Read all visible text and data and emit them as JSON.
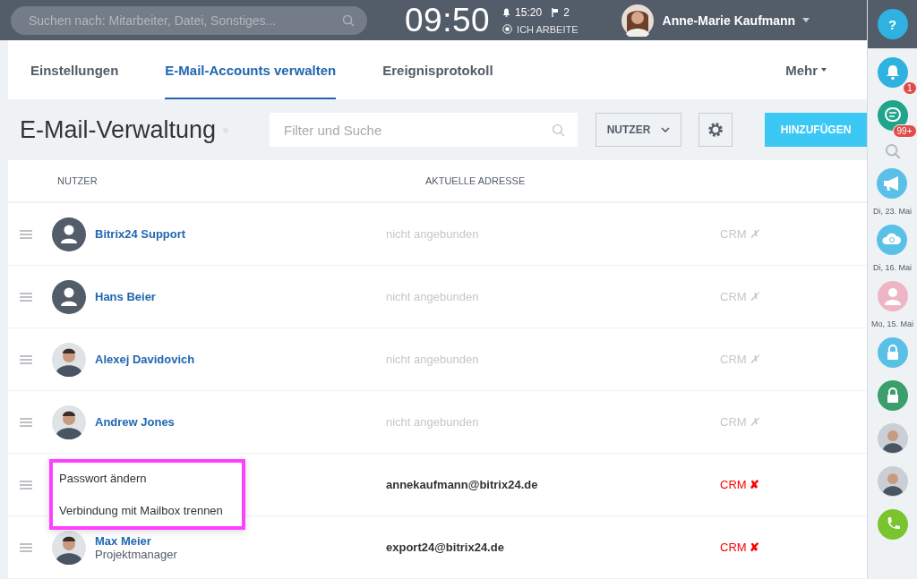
{
  "topbar": {
    "search": {
      "placeholder": "Suchen nach: Mitarbeiter, Datei, Sonstiges..."
    },
    "clock": "09:50",
    "reminder_time": "15:20",
    "flag_count": "2",
    "work_status": "ICH ARBEITE",
    "user_name": "Anne-Marie Kaufmann",
    "help": "?"
  },
  "tabs": [
    {
      "label": "Einstellungen",
      "selected": false
    },
    {
      "label": "E-Mail-Accounts verwalten",
      "selected": true
    },
    {
      "label": "Ereignisprotokoll",
      "selected": false
    }
  ],
  "more_tab": "Mehr",
  "page_title": "E-Mail-Verwaltung",
  "filter": {
    "placeholder": "Filter und Suche"
  },
  "user_dropdown": "NUTZER",
  "add_button": "HINZUFÜGEN",
  "table": {
    "columns": [
      "NUTZER",
      "AKTUELLE ADRESSE"
    ],
    "rows": [
      {
        "name": "Bitrix24 Support",
        "kind": "placeholder",
        "address": "nicht angebunden",
        "connected": false,
        "crm": "CRM",
        "crm_mark": "✗"
      },
      {
        "name": "Hans Beier",
        "kind": "placeholder",
        "address": "nicht angebunden",
        "connected": false,
        "crm": "CRM",
        "crm_mark": "✗"
      },
      {
        "name": "Alexej Davidovich",
        "kind": "photo",
        "address": "nicht angebunden",
        "connected": false,
        "crm": "CRM",
        "crm_mark": "✗"
      },
      {
        "name": "Andrew Jones",
        "kind": "photo",
        "address": "nicht angebunden",
        "connected": false,
        "crm": "CRM",
        "crm_mark": "✗"
      },
      {
        "kind": "covered",
        "address": "annekaufmann@bitrix24.de",
        "connected": true,
        "crm": "CRM",
        "crm_mark": "✘"
      },
      {
        "name": "Max Meier",
        "role": "Projektmanager",
        "kind": "photo",
        "address": "export24@bitrix24.de",
        "connected": true,
        "crm": "CRM",
        "crm_mark": "✘"
      }
    ]
  },
  "context_menu": [
    "Passwort ändern",
    "Verbindung mit Mailbox trennen"
  ],
  "sidebar": [
    {
      "kind": "bell",
      "badge": "1"
    },
    {
      "kind": "chat",
      "badge": "99+"
    },
    {
      "kind": "search"
    },
    {
      "kind": "megaphone",
      "date": "Di, 23. Mai"
    },
    {
      "kind": "cloud",
      "date": "Di, 16. Mai"
    },
    {
      "kind": "person",
      "date": "Mo, 15. Mai"
    },
    {
      "kind": "lock-blue"
    },
    {
      "kind": "lock-green"
    },
    {
      "kind": "avatar"
    },
    {
      "kind": "avatar"
    },
    {
      "kind": "phone"
    }
  ]
}
